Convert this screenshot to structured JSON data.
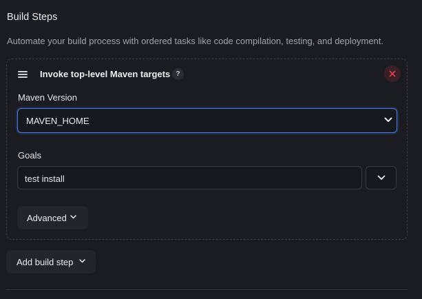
{
  "section": {
    "title": "Build Steps",
    "description": "Automate your build process with ordered tasks like code compilation, testing, and deployment."
  },
  "step": {
    "title": "Invoke top-level Maven targets",
    "help_label": "?",
    "maven_version_label": "Maven Version",
    "maven_version_value": "MAVEN_HOME",
    "goals_label": "Goals",
    "goals_value": "test install",
    "advanced_label": "Advanced"
  },
  "actions": {
    "add_build_step_label": "Add build step"
  },
  "colors": {
    "accent": "#4a7ce0",
    "close": "#e0454f",
    "background": "#1b1c22"
  }
}
